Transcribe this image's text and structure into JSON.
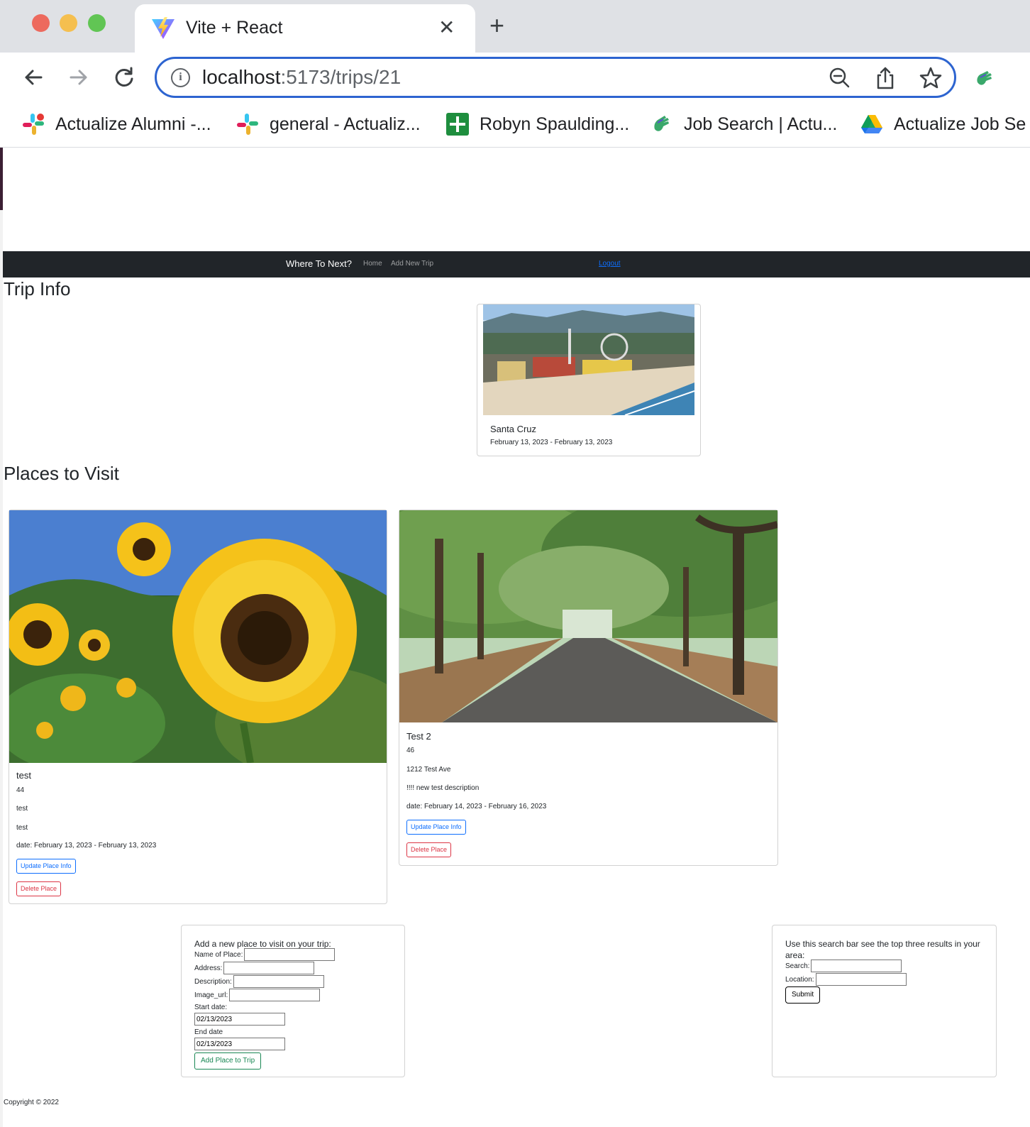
{
  "browser": {
    "tab_title": "Vite + React",
    "url_host": "localhost",
    "url_path": ":5173/trips/21",
    "bookmarks": [
      {
        "label": "Actualize Alumni -...",
        "icon": "slack-icon"
      },
      {
        "label": "general - Actualiz...",
        "icon": "slack-icon"
      },
      {
        "label": "Robyn Spaulding...",
        "icon": "plus-sheet-icon"
      },
      {
        "label": "Job Search | Actu...",
        "icon": "hand-wave-icon"
      },
      {
        "label": "Actualize Job Se",
        "icon": "google-drive-icon"
      }
    ]
  },
  "navbar": {
    "brand": "Where To Next?",
    "home": "Home",
    "add_trip": "Add New Trip",
    "logout": "Logout"
  },
  "trip": {
    "heading": "Trip Info",
    "name": "Santa Cruz",
    "dates": "February 13, 2023 - February 13, 2023"
  },
  "places": {
    "heading": "Places to Visit",
    "items": [
      {
        "name": "test",
        "id": "44",
        "address": "test",
        "description": "test",
        "date": "date: February 13, 2023 - February 13, 2023",
        "update_label": "Update Place Info",
        "delete_label": "Delete Place"
      },
      {
        "name": "Test 2",
        "id": "46",
        "address": "1212 Test Ave",
        "description": "!!!! new test description",
        "date": "date: February 14, 2023 - February 16, 2023",
        "update_label": "Update Place Info",
        "delete_label": "Delete Place"
      }
    ]
  },
  "add_form": {
    "heading": "Add a new place to visit on your trip:",
    "name_label": "Name of Place:",
    "address_label": "Address:",
    "description_label": "Description:",
    "image_label": "Image_url:",
    "start_label": "Start date:",
    "start_value": "02/13/2023",
    "end_label": "End date",
    "end_value": "02/13/2023",
    "submit_label": "Add Place to Trip"
  },
  "search_form": {
    "heading": "Use this search bar see the top three results in your area:",
    "search_label": "Search:",
    "location_label": "Location:",
    "submit_label": "Submit"
  },
  "footer": {
    "copyright": "Copyright © 2022"
  }
}
